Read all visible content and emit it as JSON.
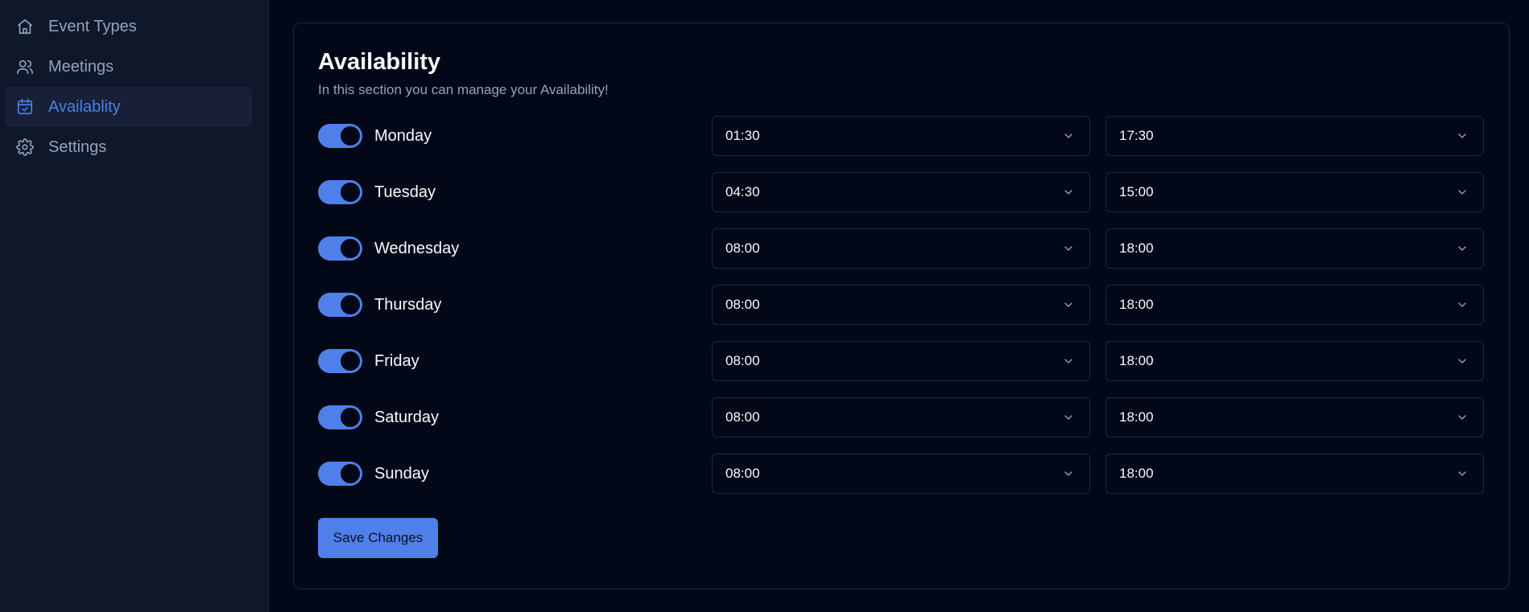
{
  "sidebar": {
    "items": [
      {
        "label": "Event Types",
        "icon": "home-icon",
        "active": false
      },
      {
        "label": "Meetings",
        "icon": "users-icon",
        "active": false
      },
      {
        "label": "Availablity",
        "icon": "calendar-check-icon",
        "active": true
      },
      {
        "label": "Settings",
        "icon": "gear-icon",
        "active": false
      }
    ]
  },
  "main": {
    "title": "Availability",
    "subtitle": "In this section you can manage your Availability!",
    "days": [
      {
        "name": "Monday",
        "enabled": true,
        "from": "01:30",
        "till": "17:30"
      },
      {
        "name": "Tuesday",
        "enabled": true,
        "from": "04:30",
        "till": "15:00"
      },
      {
        "name": "Wednesday",
        "enabled": true,
        "from": "08:00",
        "till": "18:00"
      },
      {
        "name": "Thursday",
        "enabled": true,
        "from": "08:00",
        "till": "18:00"
      },
      {
        "name": "Friday",
        "enabled": true,
        "from": "08:00",
        "till": "18:00"
      },
      {
        "name": "Saturday",
        "enabled": true,
        "from": "08:00",
        "till": "18:00"
      },
      {
        "name": "Sunday",
        "enabled": true,
        "from": "08:00",
        "till": "18:00"
      }
    ],
    "save_label": "Save Changes"
  },
  "colors": {
    "background": "#020817",
    "sidebar": "#0f172a",
    "accent": "#4f7fe8",
    "border": "#1e293b",
    "muted_text": "#94a3b8"
  }
}
